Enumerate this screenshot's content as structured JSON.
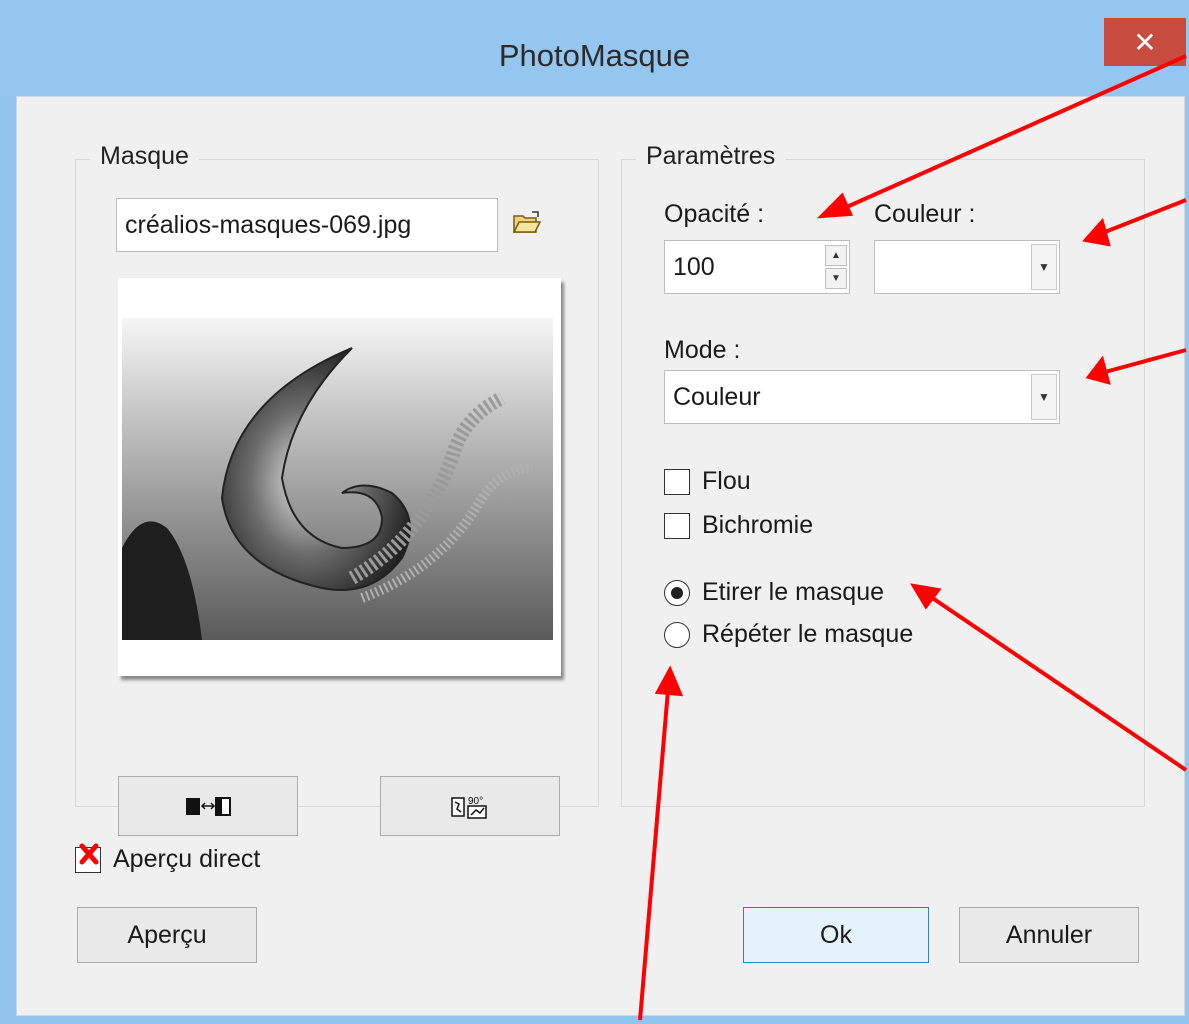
{
  "window": {
    "title": "PhotoMasque",
    "close_glyph": "✕"
  },
  "mask_group": {
    "legend": "Masque",
    "file_value": "créalios-masques-069.jpg",
    "open_icon": "folder-open-icon",
    "invert_icon": "invert-mask-icon",
    "rotate_icon": "rotate-90-icon",
    "rotate_label": "90°"
  },
  "params_group": {
    "legend": "Paramètres",
    "opacity_label": "Opacité :",
    "opacity_value": "100",
    "color_label": "Couleur :",
    "mode_label": "Mode :",
    "mode_value": "Couleur",
    "blur_label": "Flou",
    "bichrome_label": "Bichromie",
    "stretch_label": "Etirer le masque",
    "repeat_label": "Répéter le masque"
  },
  "footer": {
    "live_preview_label": "Aperçu direct",
    "preview_button": "Aperçu",
    "ok_button": "Ok",
    "cancel_button": "Annuler"
  },
  "annotation_color": "#ff0000"
}
